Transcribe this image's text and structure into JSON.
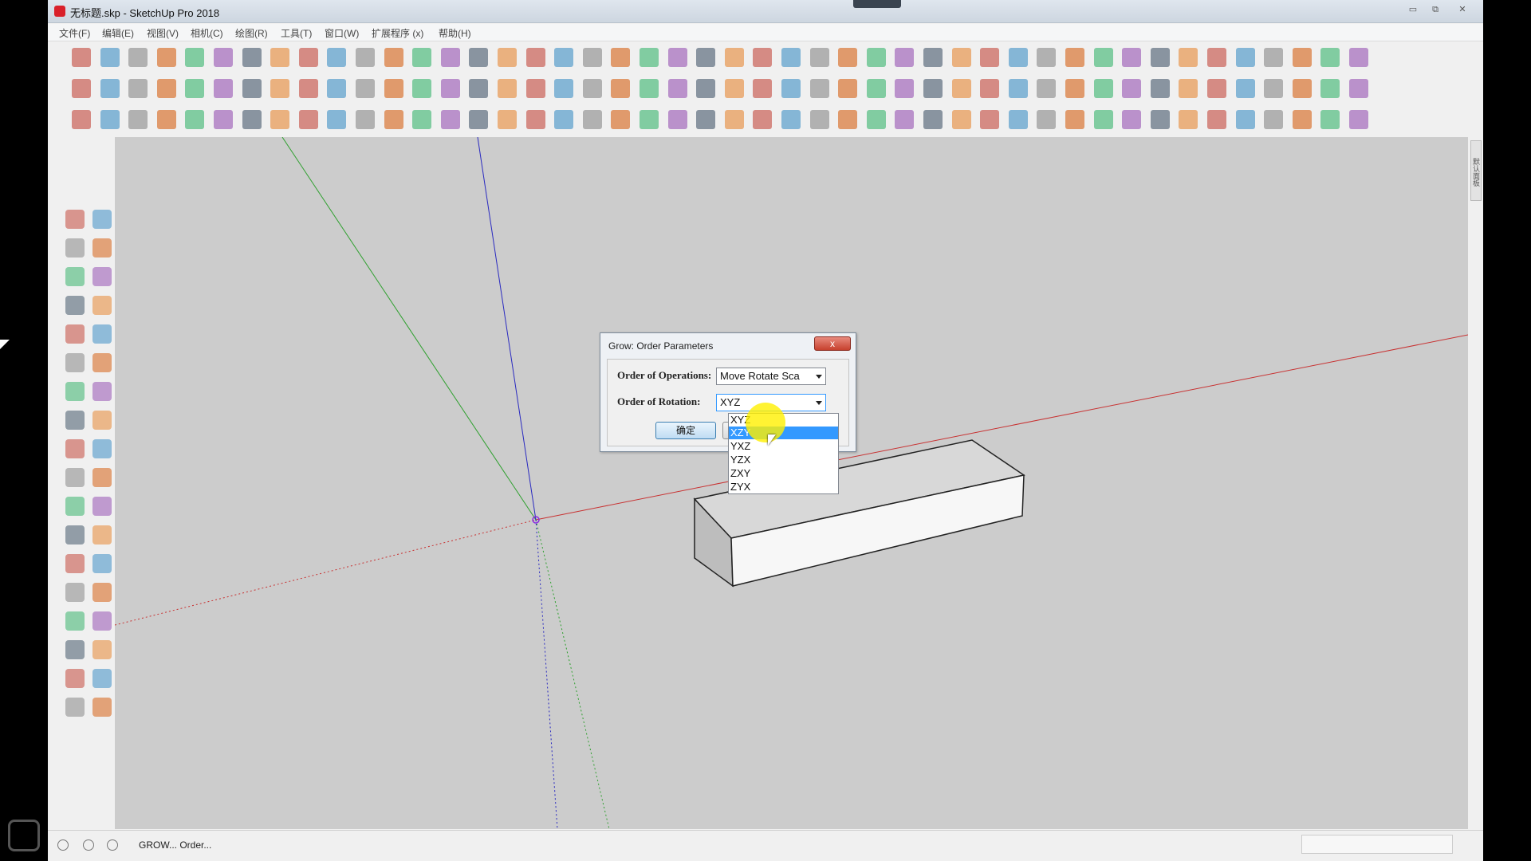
{
  "window": {
    "title": "无标题.skp - SketchUp Pro 2018",
    "minimize": "▭",
    "maximize": "⧉",
    "close": "✕"
  },
  "menubar": {
    "items": [
      "文件(F)",
      "编辑(E)",
      "视图(V)",
      "相机(C)",
      "绘图(R)",
      "工具(T)",
      "窗口(W)",
      "扩展程序 (x)",
      "帮助(H)"
    ]
  },
  "right_panel": {
    "tab_label": "默认面板"
  },
  "dialog": {
    "title": "Grow: Order Parameters",
    "close_label": "x",
    "operations_label": "Order of Operations:",
    "operations_value": "Move Rotate Sca",
    "rotation_label": "Order of Rotation:",
    "rotation_value": "XYZ",
    "ok_label": "确定",
    "rotation_options": [
      "XYZ",
      "XZY",
      "YXZ",
      "YZX",
      "ZXY",
      "ZYX"
    ],
    "selected_option": "XZY"
  },
  "statusbar": {
    "text": "GROW... Order..."
  },
  "colors": {
    "viewport_bg": "#cccccc",
    "axis_red": "#c83232",
    "axis_green": "#2fa02f",
    "axis_blue": "#2929c0",
    "selection_blue": "#3399ff",
    "highlight_yellow": "#fff000"
  },
  "icons": {
    "toolbar": "sketchup-tool-icons",
    "left_tools": "sketchup-large-tool-set"
  }
}
